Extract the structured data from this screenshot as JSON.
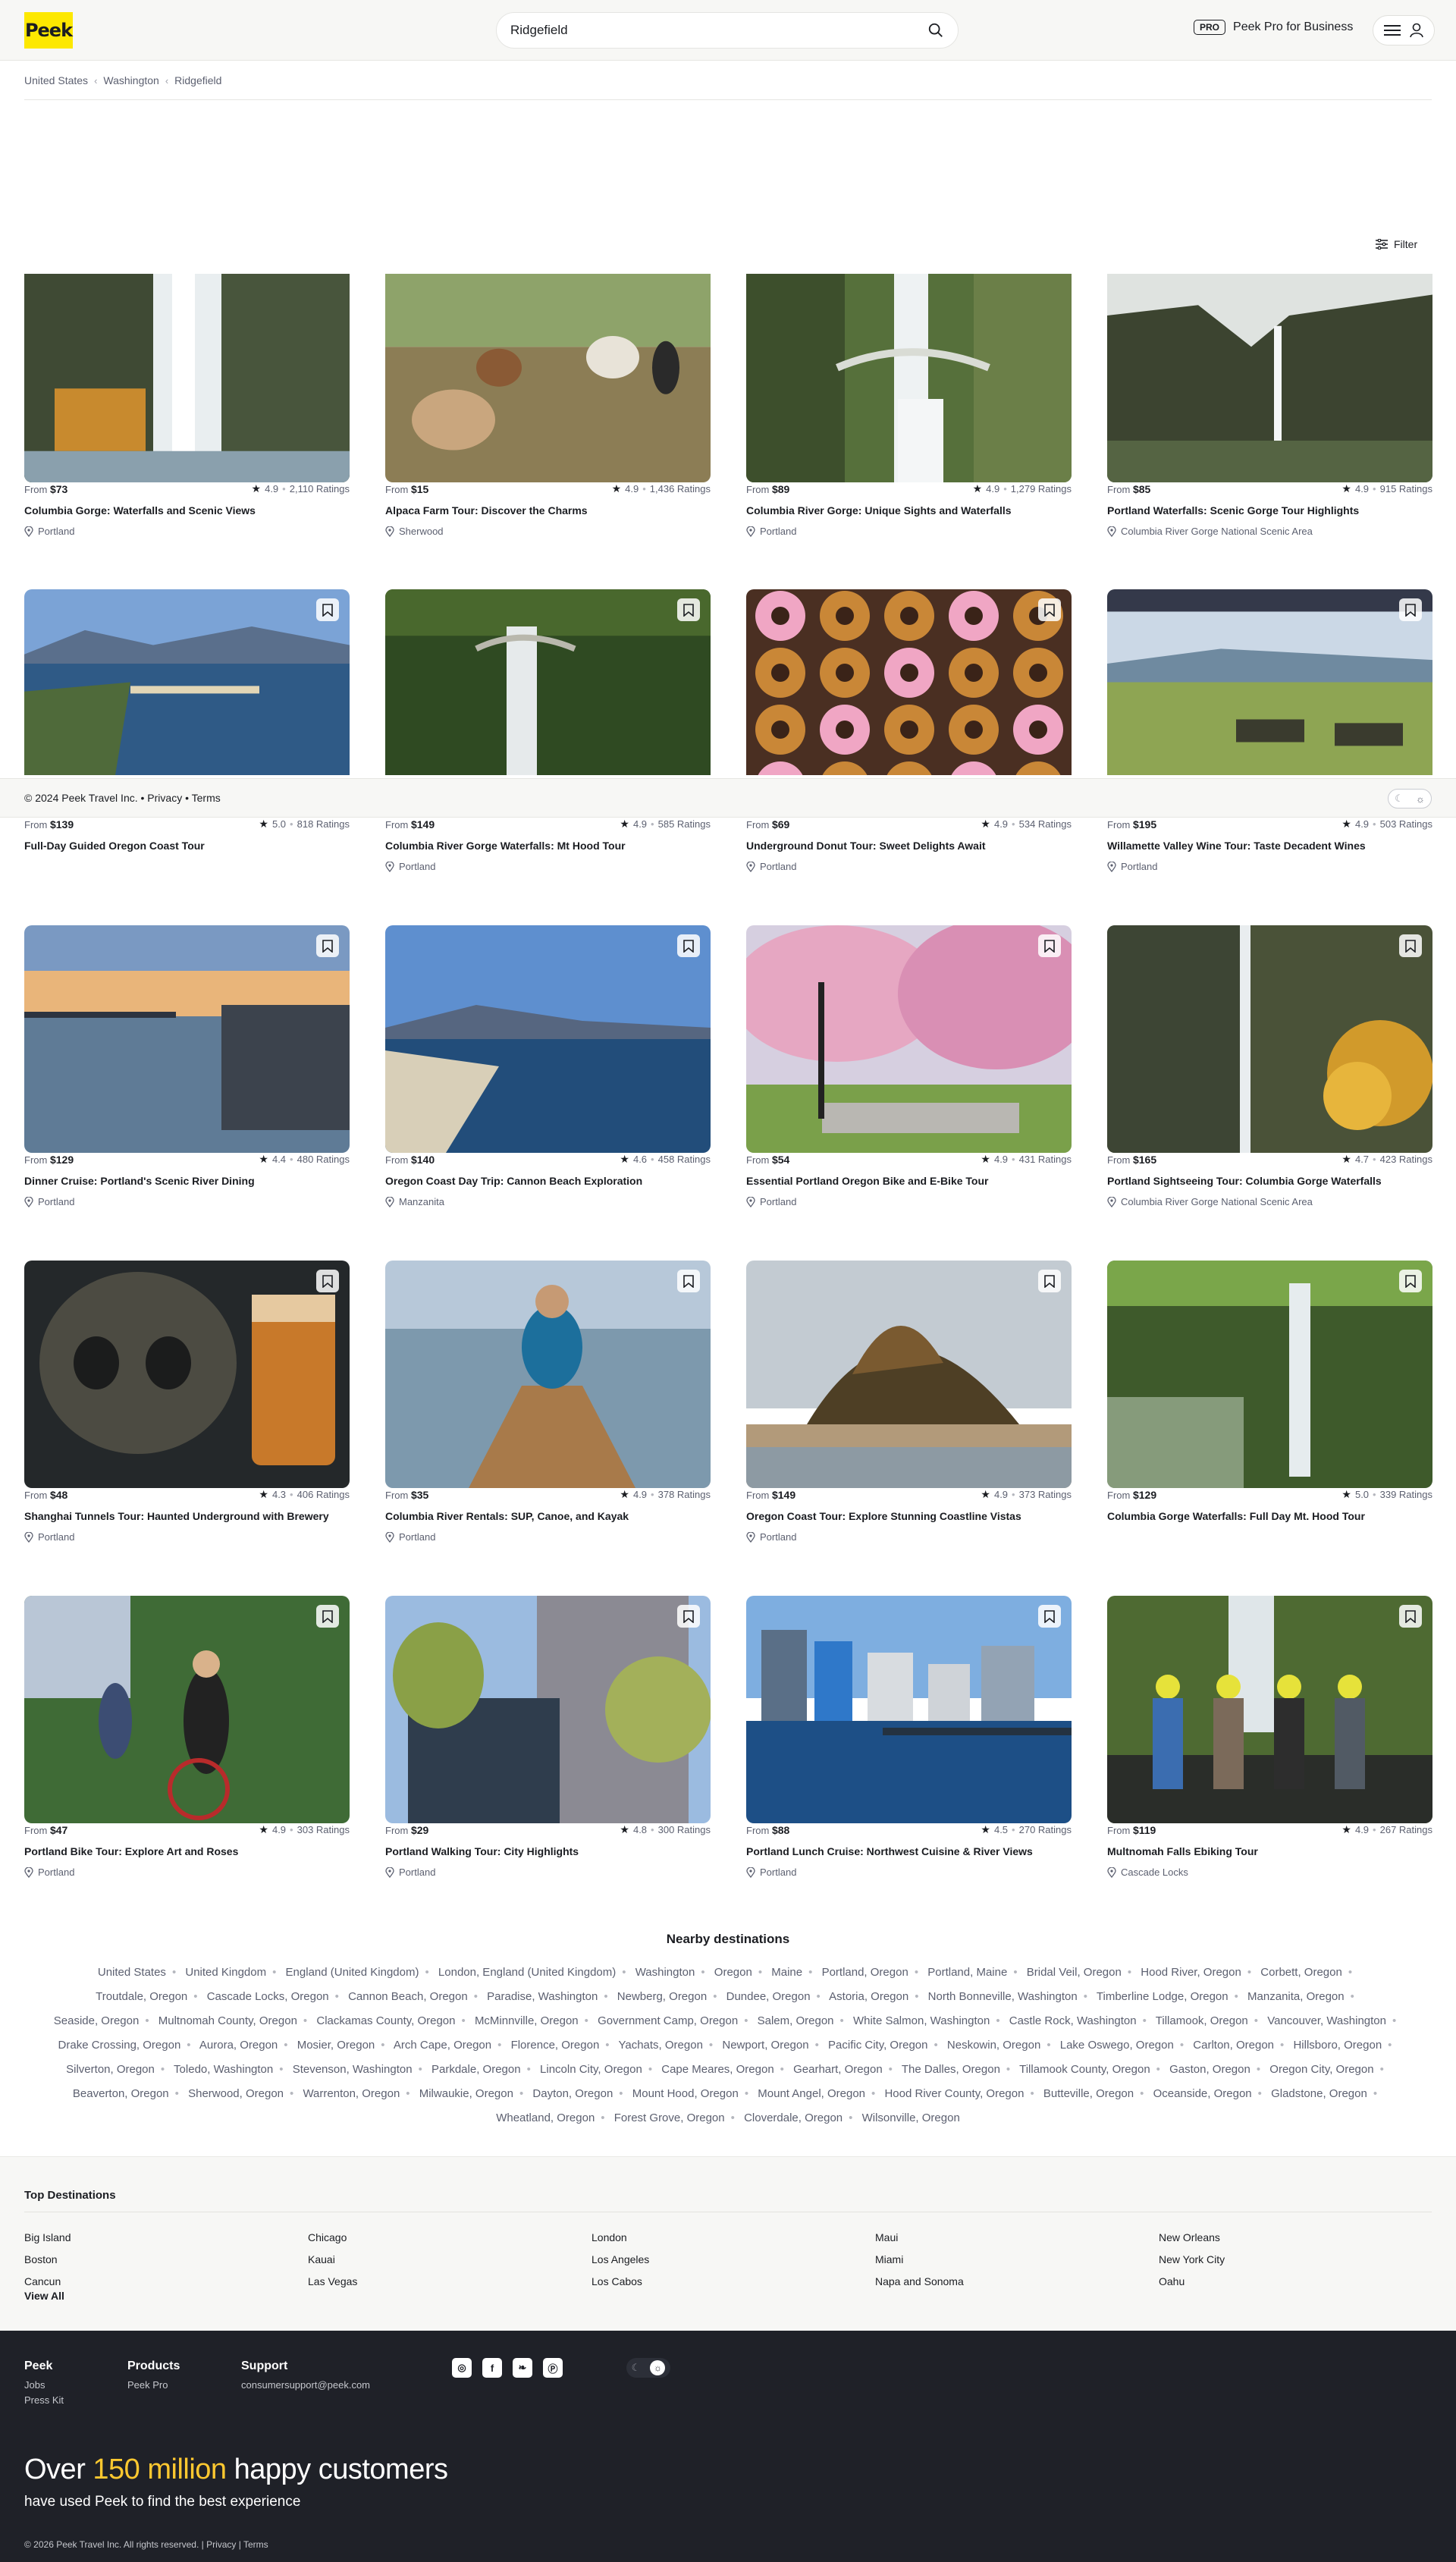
{
  "header": {
    "logo_text": "Peek",
    "search_value": "Ridgefield",
    "pro_badge": "PRO",
    "pro_label": "Peek Pro for Business"
  },
  "breadcrumb": [
    "United States",
    "Washington",
    "Ridgefield"
  ],
  "filter_label": "Filter",
  "floatbar": {
    "text": "© 2024 Peek Travel Inc. • Privacy • Terms"
  },
  "cards": [
    {
      "price": "$73",
      "rating": "4.9",
      "ratings": "2,110 Ratings",
      "title": "Columbia Gorge: Waterfalls and Scenic Views",
      "location": "Portland"
    },
    {
      "price": "$15",
      "rating": "4.9",
      "ratings": "1,436 Ratings",
      "title": "Alpaca Farm Tour: Discover the Charms",
      "location": "Sherwood"
    },
    {
      "price": "$89",
      "rating": "4.9",
      "ratings": "1,279 Ratings",
      "title": "Columbia River Gorge: Unique Sights and Waterfalls",
      "location": "Portland"
    },
    {
      "price": "$85",
      "rating": "4.9",
      "ratings": "915 Ratings",
      "title": "Portland Waterfalls: Scenic Gorge Tour Highlights",
      "location": "Columbia River Gorge National Scenic Area"
    },
    {
      "price": "$139",
      "rating": "5.0",
      "ratings": "818 Ratings",
      "title": "Full-Day Guided Oregon Coast Tour",
      "location": ""
    },
    {
      "price": "$149",
      "rating": "4.9",
      "ratings": "585 Ratings",
      "title": "Columbia River Gorge Waterfalls: Mt Hood Tour",
      "location": "Portland"
    },
    {
      "price": "$69",
      "rating": "4.9",
      "ratings": "534 Ratings",
      "title": "Underground Donut Tour: Sweet Delights Await",
      "location": "Portland"
    },
    {
      "price": "$195",
      "rating": "4.9",
      "ratings": "503 Ratings",
      "title": "Willamette Valley Wine Tour: Taste Decadent Wines",
      "location": "Portland"
    },
    {
      "price": "$129",
      "rating": "4.4",
      "ratings": "480 Ratings",
      "title": "Dinner Cruise: Portland's Scenic River Dining",
      "location": "Portland"
    },
    {
      "price": "$140",
      "rating": "4.6",
      "ratings": "458 Ratings",
      "title": "Oregon Coast Day Trip: Cannon Beach Exploration",
      "location": "Manzanita"
    },
    {
      "price": "$54",
      "rating": "4.9",
      "ratings": "431 Ratings",
      "title": "Essential Portland Oregon Bike and E-Bike Tour",
      "location": "Portland"
    },
    {
      "price": "$165",
      "rating": "4.7",
      "ratings": "423 Ratings",
      "title": "Portland Sightseeing Tour: Columbia Gorge Waterfalls",
      "location": "Columbia River Gorge National Scenic Area"
    },
    {
      "price": "$48",
      "rating": "4.3",
      "ratings": "406 Ratings",
      "title": "Shanghai Tunnels Tour: Haunted Underground with Brewery",
      "location": "Portland"
    },
    {
      "price": "$35",
      "rating": "4.9",
      "ratings": "378 Ratings",
      "title": "Columbia River Rentals: SUP, Canoe, and Kayak",
      "location": "Portland"
    },
    {
      "price": "$149",
      "rating": "4.9",
      "ratings": "373 Ratings",
      "title": "Oregon Coast Tour: Explore Stunning Coastline Vistas",
      "location": "Portland"
    },
    {
      "price": "$129",
      "rating": "5.0",
      "ratings": "339 Ratings",
      "title": "Columbia Gorge Waterfalls: Full Day Mt. Hood Tour",
      "location": ""
    },
    {
      "price": "$47",
      "rating": "4.9",
      "ratings": "303 Ratings",
      "title": "Portland Bike Tour: Explore Art and Roses",
      "location": "Portland"
    },
    {
      "price": "$29",
      "rating": "4.8",
      "ratings": "300 Ratings",
      "title": "Portland Walking Tour: City Highlights",
      "location": "Portland"
    },
    {
      "price": "$88",
      "rating": "4.5",
      "ratings": "270 Ratings",
      "title": "Portland Lunch Cruise: Northwest Cuisine & River Views",
      "location": "Portland"
    },
    {
      "price": "$119",
      "rating": "4.9",
      "ratings": "267 Ratings",
      "title": "Multnomah Falls Ebiking Tour",
      "location": "Cascade Locks"
    }
  ],
  "from_label": "From",
  "nearby": {
    "title": "Nearby destinations",
    "links": [
      "United States",
      "United Kingdom",
      "England (United Kingdom)",
      "London, England (United Kingdom)",
      "Washington",
      "Oregon",
      "Maine",
      "Portland, Oregon",
      "Portland, Maine",
      "Bridal Veil, Oregon",
      "Hood River, Oregon",
      "Corbett, Oregon",
      "Troutdale, Oregon",
      "Cascade Locks, Oregon",
      "Cannon Beach, Oregon",
      "Paradise, Washington",
      "Newberg, Oregon",
      "Dundee, Oregon",
      "Astoria, Oregon",
      "North Bonneville, Washington",
      "Timberline Lodge, Oregon",
      "Manzanita, Oregon",
      "Seaside, Oregon",
      "Multnomah County, Oregon",
      "Clackamas County, Oregon",
      "McMinnville, Oregon",
      "Government Camp, Oregon",
      "Salem, Oregon",
      "White Salmon, Washington",
      "Castle Rock, Washington",
      "Tillamook, Oregon",
      "Vancouver, Washington",
      "Drake Crossing, Oregon",
      "Aurora, Oregon",
      "Mosier, Oregon",
      "Arch Cape, Oregon",
      "Florence, Oregon",
      "Yachats, Oregon",
      "Newport, Oregon",
      "Pacific City, Oregon",
      "Neskowin, Oregon",
      "Lake Oswego, Oregon",
      "Carlton, Oregon",
      "Hillsboro, Oregon",
      "Silverton, Oregon",
      "Toledo, Washington",
      "Stevenson, Washington",
      "Parkdale, Oregon",
      "Lincoln City, Oregon",
      "Cape Meares, Oregon",
      "Gearhart, Oregon",
      "The Dalles, Oregon",
      "Tillamook County, Oregon",
      "Gaston, Oregon",
      "Oregon City, Oregon",
      "Beaverton, Oregon",
      "Sherwood, Oregon",
      "Warrenton, Oregon",
      "Milwaukie, Oregon",
      "Dayton, Oregon",
      "Mount Hood, Oregon",
      "Mount Angel, Oregon",
      "Hood River County, Oregon",
      "Butteville, Oregon",
      "Oceanside, Oregon",
      "Gladstone, Oregon",
      "Wheatland, Oregon",
      "Forest Grove, Oregon",
      "Cloverdale, Oregon",
      "Wilsonville, Oregon"
    ]
  },
  "top_destinations": {
    "title": "Top Destinations",
    "columns": [
      [
        "Big Island",
        "Boston",
        "Cancun"
      ],
      [
        "Chicago",
        "Kauai",
        "Las Vegas"
      ],
      [
        "London",
        "Los Angeles",
        "Los Cabos"
      ],
      [
        "Maui",
        "Miami",
        "Napa and Sonoma"
      ],
      [
        "New Orleans",
        "New York City",
        "Oahu"
      ]
    ],
    "view_all": "View All"
  },
  "footer": {
    "col1": {
      "title": "Peek",
      "links": [
        "Jobs",
        "Press Kit"
      ]
    },
    "col2": {
      "title": "Products",
      "links": [
        "Peek Pro"
      ]
    },
    "col3": {
      "title": "Support",
      "links": [
        "consumersupport@peek.com"
      ]
    },
    "big_pre": "Over ",
    "big_highlight": "150 million",
    "big_post": " happy customers",
    "sub": "have used Peek to find the best experience",
    "copyright": "© 2026 Peek Travel Inc. All rights reserved. | Privacy | Terms"
  }
}
